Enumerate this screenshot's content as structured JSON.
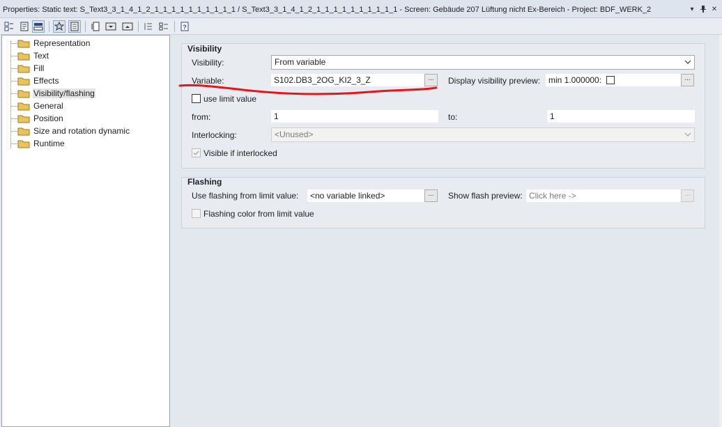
{
  "window": {
    "title": "Properties: Static text: S_Text3_3_1_4_1_2_1_1_1_1_1_1_1_1_1_1 / S_Text3_3_1_4_1_2_1_1_1_1_1_1_1_1_1_1 - Screen: Gebäude 207 Lüftung nicht Ex-Bereich - Project: BDF_WERK_2",
    "pin_glyph": "▾ ᵠ ✕"
  },
  "toolbar": {
    "icons": [
      "categorized-icon",
      "properties-page-icon",
      "grid-view-icon",
      "favorites-star-icon",
      "list-view-icon",
      "sort-icon",
      "collapse-icon",
      "expand-icon",
      "layout-left-icon",
      "layout-tree-icon",
      "help-icon"
    ]
  },
  "tree": {
    "items": [
      {
        "label": "Representation"
      },
      {
        "label": "Text"
      },
      {
        "label": "Fill"
      },
      {
        "label": "Effects"
      },
      {
        "label": "Visibility/flashing"
      },
      {
        "label": "General"
      },
      {
        "label": "Position"
      },
      {
        "label": "Size and rotation dynamic"
      },
      {
        "label": "Runtime"
      }
    ],
    "selected": "Visibility/flashing"
  },
  "visibility": {
    "group_title": "Visibility",
    "visibility_label": "Visibility:",
    "visibility_value": "From variable",
    "variable_label": "Variable:",
    "variable_value": "S102.DB3_2OG_KI2_3_Z",
    "browse_label": "...",
    "preview_label": "Display visibility preview:",
    "preview_value": "min 1.000000:",
    "use_limit_label": "use limit value",
    "from_label": "from:",
    "from_value": "1",
    "to_label": "to:",
    "to_value": "1",
    "interlocking_label": "Interlocking:",
    "interlocking_value": "<Unused>",
    "visible_if_interlocked_label": "Visible if interlocked"
  },
  "flashing": {
    "group_title": "Flashing",
    "use_flashing_label": "Use flashing from limit value:",
    "use_flashing_value": "<no variable linked>",
    "show_preview_label": "Show flash preview:",
    "show_preview_value": "Click here ->",
    "flashing_color_label": "Flashing color from limit value"
  },
  "colors": {
    "annotation": "#e8141b",
    "panel_bg": "#e3e8ee",
    "folder": "#e9c45c"
  }
}
